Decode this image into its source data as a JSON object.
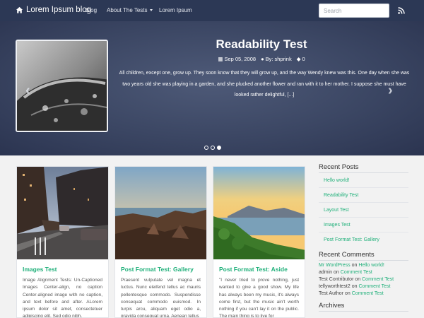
{
  "nav": {
    "brand": "Lorem Ipsum blog",
    "links": [
      "Blog",
      "About The Tests",
      "Lorem Ipsum"
    ],
    "search_placeholder": "Search"
  },
  "hero": {
    "title": "Readability Test",
    "date": "Sep 05, 2008",
    "author": "By: shprink",
    "comments": "0",
    "excerpt": "All children, except one, grow up. They soon know that they will grow up, and the way Wendy knew was this. One day when she was two years old she was playing in a garden, and she plucked another flower and ran with it to her mother. I suppose she must have looked rather delightful, [...]",
    "prev_arrow": "‹",
    "next_arrow": "›"
  },
  "posts": [
    {
      "title": "Images Test",
      "excerpt": "Image Alignment Tests: Un-Captioned Images Center-align, no caption Center-aligned image with no caption, and text before and after. ALorem ipsum dolor sit amet, consectetuer adipiscing elit. Sed odio nibh,"
    },
    {
      "title": "Post Format Test: Gallery",
      "excerpt": "Praesent vulputate vel magna et luctus. Nunc eleifend tellus ac mauris pellentesque commodo. Suspendisse consequat commodo euismod. In turpis arcu, aliquam eget odio a, gravida consequat urna. Aenean tellus"
    },
    {
      "title": "Post Format Test: Aside",
      "excerpt": "\"I never tried to prove nothing, just wanted to give a good show. My life has always been my music, it's always come first, but the music ain't worth nothing if you can't lay it on the public. The main thing is to live for"
    }
  ],
  "sidebar": {
    "recent_posts_heading": "Recent Posts",
    "recent_posts": [
      "Hello world!",
      "Readability Test",
      "Layout Test",
      "Images Test",
      "Post Format Test: Gallery"
    ],
    "recent_comments_heading": "Recent Comments",
    "recent_comments": [
      {
        "author": "Mr WordPress",
        "on": "on",
        "post": "Hello world!"
      },
      {
        "author": "admin",
        "on": "on",
        "post": "Comment Test"
      },
      {
        "author": "Test Contributor",
        "on": "on",
        "post": "Comment Test"
      },
      {
        "author": "tellyworthtest2",
        "on": "on",
        "post": "Comment Test"
      },
      {
        "author": "Test Author",
        "on": "on",
        "post": "Comment Test"
      }
    ],
    "archives_heading": "Archives"
  },
  "colors": {
    "accent": "#20b07a",
    "navbar": "#2c3855",
    "hero": "#3b4663"
  }
}
